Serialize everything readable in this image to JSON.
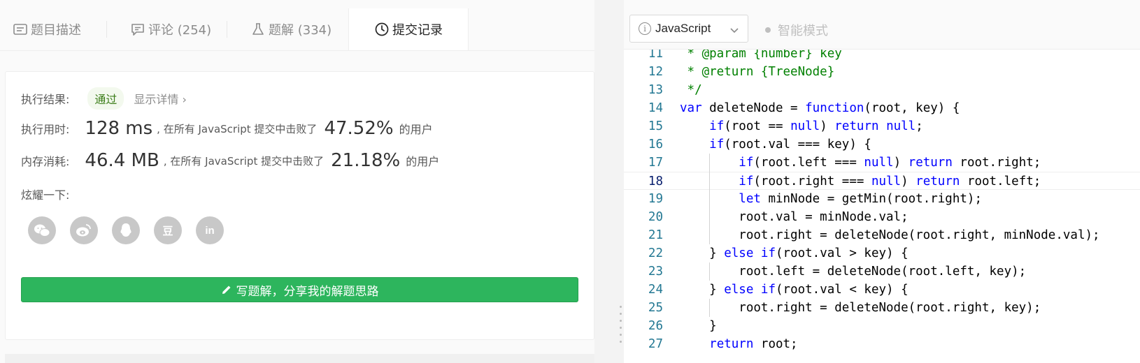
{
  "tabs": [
    {
      "label": "题目描述",
      "icon": "description-icon"
    },
    {
      "label": "评论 (254)",
      "icon": "comment-icon"
    },
    {
      "label": "题解 (334)",
      "icon": "flask-icon"
    },
    {
      "label": "提交记录",
      "icon": "clock-icon",
      "active": true
    }
  ],
  "result": {
    "label": "执行结果:",
    "status": "通过",
    "detail_link": "显示详情 ›"
  },
  "runtime": {
    "label": "执行用时:",
    "value": "128 ms",
    "desc": ", 在所有 JavaScript 提交中击败了",
    "percent": "47.52%",
    "suffix": "的用户"
  },
  "memory": {
    "label": "内存消耗:",
    "value": "46.4 MB",
    "desc": ", 在所有 JavaScript 提交中击败了",
    "percent": "21.18%",
    "suffix": "的用户"
  },
  "share": {
    "label": "炫耀一下:",
    "icons": [
      "wechat-icon",
      "weibo-icon",
      "qq-icon",
      "douban-icon",
      "linkedin-icon"
    ],
    "douban_glyph": "豆",
    "linkedin_glyph": "in"
  },
  "write_button": "写题解，分享我的解题思路",
  "editor": {
    "language": "JavaScript",
    "smart_mode": "智能模式",
    "current_line": 18,
    "lines": [
      {
        "n": 11,
        "t": " * @param {number} key"
      },
      {
        "n": 12,
        "t": " * @return {TreeNode}"
      },
      {
        "n": 13,
        "t": " */"
      },
      {
        "n": 14,
        "t": "var deleteNode = function(root, key) {"
      },
      {
        "n": 15,
        "t": "    if(root == null) return null;"
      },
      {
        "n": 16,
        "t": "    if(root.val === key) {"
      },
      {
        "n": 17,
        "t": "        if(root.left === null) return root.right;"
      },
      {
        "n": 18,
        "t": "        if(root.right === null) return root.left;"
      },
      {
        "n": 19,
        "t": "        let minNode = getMin(root.right);"
      },
      {
        "n": 20,
        "t": "        root.val = minNode.val;"
      },
      {
        "n": 21,
        "t": "        root.right = deleteNode(root.right, minNode.val);"
      },
      {
        "n": 22,
        "t": "    } else if(root.val > key) {"
      },
      {
        "n": 23,
        "t": "        root.left = deleteNode(root.left, key);"
      },
      {
        "n": 24,
        "t": "    } else if(root.val < key) {"
      },
      {
        "n": 25,
        "t": "        root.right = deleteNode(root.right, key);"
      },
      {
        "n": 26,
        "t": "    }"
      },
      {
        "n": 27,
        "t": "    return root;"
      }
    ]
  },
  "colors": {
    "accent_green": "#2db55d",
    "pass_text": "#3b7d18",
    "keyword": "#0000ff",
    "comment": "#008000",
    "line_number": "#237893"
  }
}
